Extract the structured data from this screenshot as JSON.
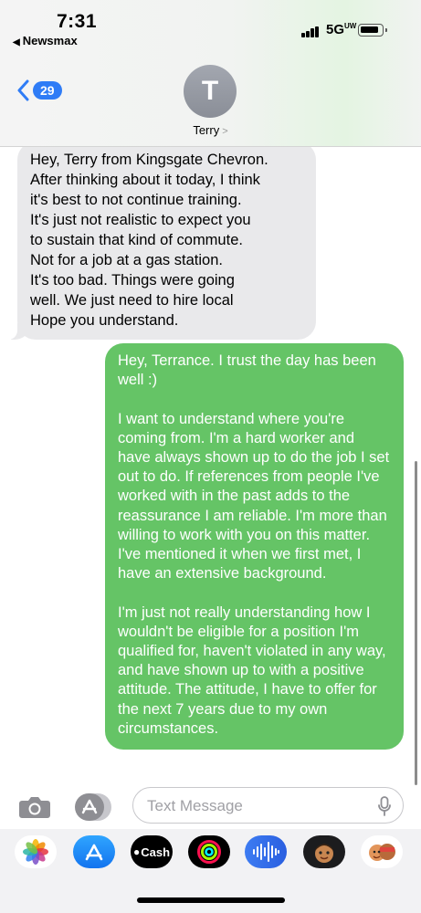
{
  "status_bar": {
    "time": "7:31",
    "back_app": "Newsmax",
    "network": "5G",
    "network_sup": "UW"
  },
  "header": {
    "back_badge": "29",
    "avatar_initial": "T",
    "contact_name": "Terry"
  },
  "messages": [
    {
      "direction": "incoming",
      "lines": [
        "Hey, Terry from Kingsgate Chevron.",
        "After thinking about it today, I think",
        "it's best to not continue training.",
        "It's just not realistic to expect you",
        "to sustain that kind of commute.",
        "Not for a job at a gas station.",
        "It's too bad. Things were going",
        "well. We just need to hire local",
        "Hope you understand."
      ]
    },
    {
      "direction": "outgoing",
      "text": "Hey, Terrance. I trust the day has been well :)\n\nI want to understand where you're coming from. I'm a hard worker and have always shown up to do the job I set out to do. If references from people I've worked with in the past adds to the reassurance I am reliable. I'm more than willing to work with you on this matter. I've mentioned it when we first met, I have an extensive background.\n\nI'm just not really understanding how I wouldn't be eligible for a position I'm qualified for, haven't violated in any way, and have shown up to with a positive attitude. The attitude, I have to offer for the next 7 years due to my own circumstances."
    }
  ],
  "input": {
    "placeholder": "Text Message"
  },
  "app_drawer": {
    "apps": [
      "photos-icon",
      "app-store-icon",
      "apple-cash-icon",
      "fitness-rings-icon",
      "audio-message-icon",
      "memoji-icon",
      "memoji-sticker-icon"
    ],
    "cash_label": "Cash"
  },
  "colors": {
    "outgoing_bubble": "#65c466",
    "incoming_bubble": "#e9e9eb",
    "accent_blue": "#2f7cf6"
  }
}
